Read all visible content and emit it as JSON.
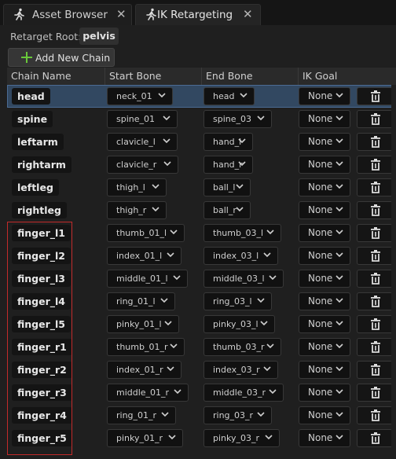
{
  "tabs": [
    {
      "label": "Asset Browser",
      "icon": "running-man-icon"
    },
    {
      "label": "IK Retargeting",
      "icon": "running-man-icon"
    }
  ],
  "toolbar": {
    "retarget_root_label": "Retarget Root:",
    "retarget_root_value": "pelvis",
    "add_chain_label": "Add New Chain"
  },
  "table": {
    "headers": [
      "Chain Name",
      "Start Bone",
      "End Bone",
      "IK Goal"
    ],
    "rows": [
      {
        "name": "head",
        "start": "neck_01",
        "end": "head",
        "goal": "None"
      },
      {
        "name": "spine",
        "start": "spine_01",
        "end": "spine_03",
        "goal": "None"
      },
      {
        "name": "leftarm",
        "start": "clavicle_l",
        "end": "hand_l",
        "goal": "None"
      },
      {
        "name": "rightarm",
        "start": "clavicle_r",
        "end": "hand_r",
        "goal": "None"
      },
      {
        "name": "leftleg",
        "start": "thigh_l",
        "end": "ball_l",
        "goal": "None"
      },
      {
        "name": "rightleg",
        "start": "thigh_r",
        "end": "ball_r",
        "goal": "None"
      },
      {
        "name": "finger_l1",
        "start": "thumb_01_l",
        "end": "thumb_03_l",
        "goal": "None"
      },
      {
        "name": "finger_l2",
        "start": "index_01_l",
        "end": "index_03_l",
        "goal": "None"
      },
      {
        "name": "finger_l3",
        "start": "middle_01_l",
        "end": "middle_03_l",
        "goal": "None"
      },
      {
        "name": "finger_l4",
        "start": "ring_01_l",
        "end": "ring_03_l",
        "goal": "None"
      },
      {
        "name": "finger_l5",
        "start": "pinky_01_l",
        "end": "pinky_03_l",
        "goal": "None"
      },
      {
        "name": "finger_r1",
        "start": "thumb_01_r",
        "end": "thumb_03_r",
        "goal": "None"
      },
      {
        "name": "finger_r2",
        "start": "index_01_r",
        "end": "index_03_r",
        "goal": "None"
      },
      {
        "name": "finger_r3",
        "start": "middle_01_r",
        "end": "middle_03_r",
        "goal": "None"
      },
      {
        "name": "finger_r4",
        "start": "ring_01_r",
        "end": "ring_03_r",
        "goal": "None"
      },
      {
        "name": "finger_r5",
        "start": "pinky_01_r",
        "end": "pinky_03_r",
        "goal": "None"
      }
    ]
  },
  "colors": {
    "selection": "#324861",
    "highlight_box": "#c22a2a",
    "add_icon": "#69c93a"
  }
}
